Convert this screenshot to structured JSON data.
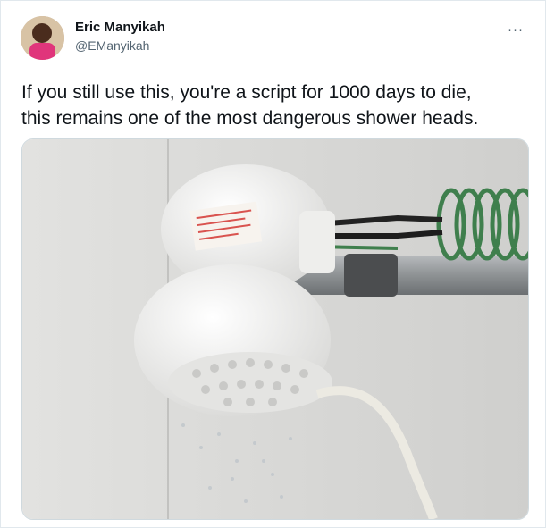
{
  "author": {
    "display_name": "Eric Manyikah",
    "handle": "@EManyikah",
    "avatar": "avatar-photo"
  },
  "menu": {
    "icon": "more-icon",
    "glyph": "···"
  },
  "tweet": {
    "line1": "If you still use this, you're a script for 1000 days to die,",
    "line2": "this remains one of the most dangerous shower heads."
  },
  "media": {
    "kind": "photo",
    "subject": "electric-shower-head-photo",
    "colors": {
      "wall": "#d6d6d4",
      "shower_body": "#f2f2f0",
      "pipe": "#8e9294",
      "coil_wire": "#3f7f4d",
      "label": "#d9534f"
    }
  }
}
